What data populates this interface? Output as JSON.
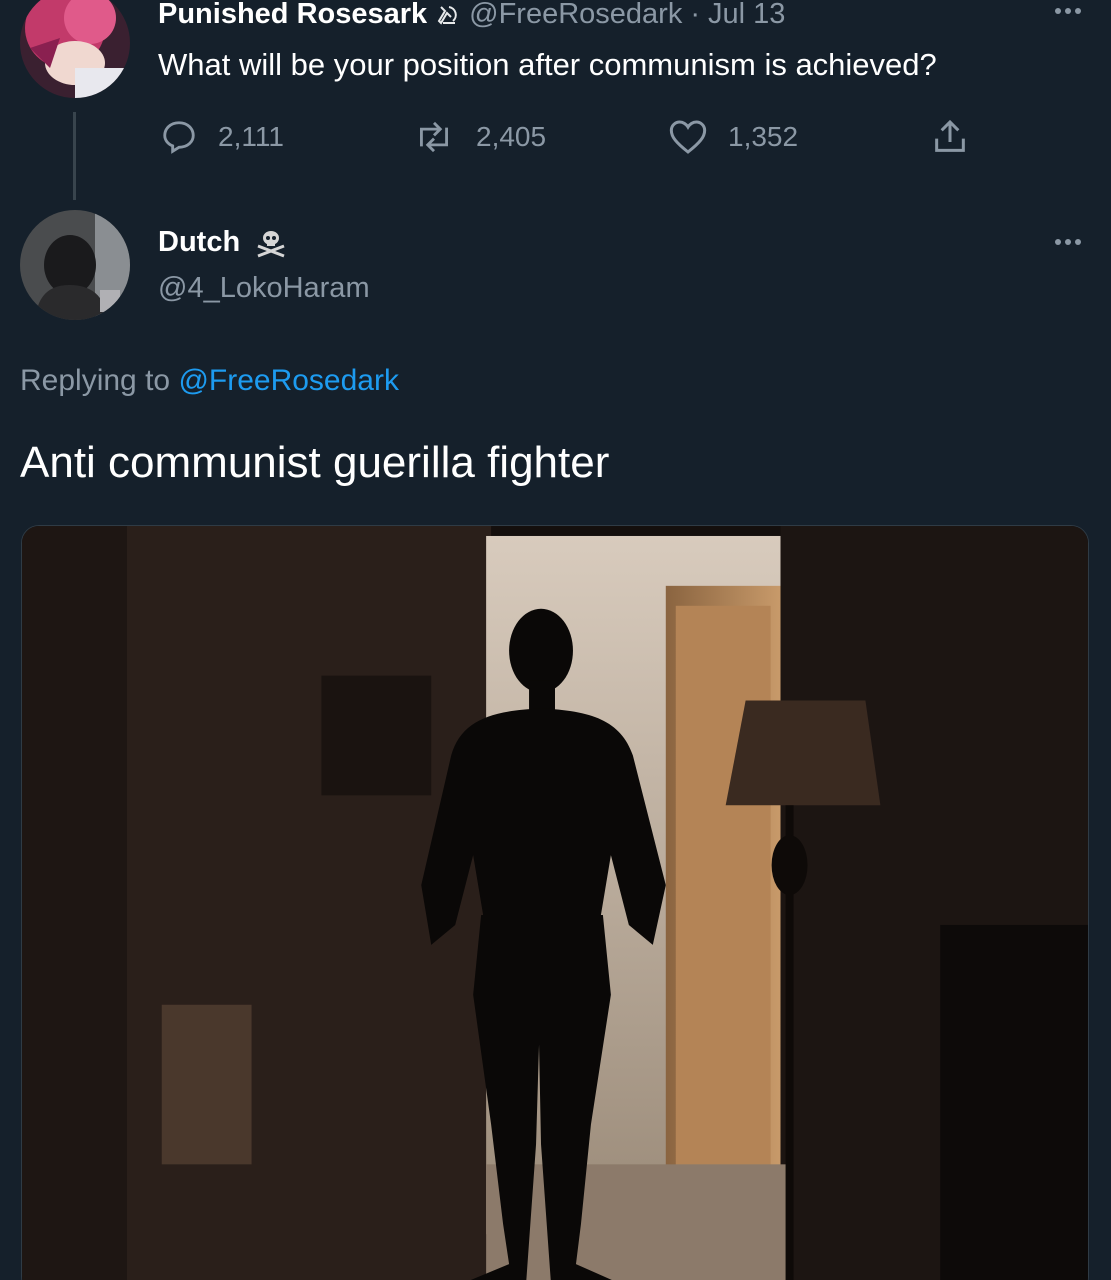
{
  "original_tweet": {
    "display_name": "Punished Rosesark",
    "handle": "@FreeRosedark",
    "separator": "·",
    "date": "Jul 13",
    "text": "What will be your position after communism is achieved?",
    "badge_icon": "hammer-sickle-icon",
    "stats": {
      "replies": "2,111",
      "retweets": "2,405",
      "likes": "1,352"
    }
  },
  "reply_tweet": {
    "display_name": "Dutch",
    "badge_icon": "skull-crossbones-icon",
    "handle": "@4_LokoHaram",
    "replying_prefix": "Replying to",
    "replying_to": "@FreeRosedark",
    "text": "Anti communist guerilla fighter",
    "media_icon": "photo-silhouette-bodybuilder"
  },
  "colors": {
    "background": "#15202b",
    "secondary_text": "#8b98a5",
    "link": "#1d9bf0"
  }
}
